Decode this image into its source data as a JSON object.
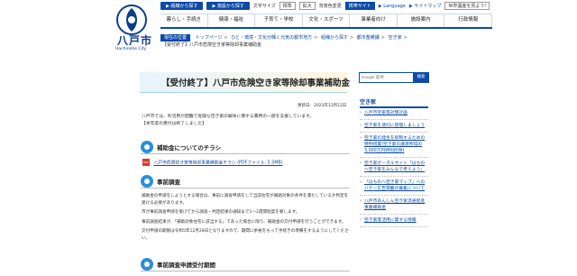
{
  "logo": {
    "city": "八戸市",
    "en": "Hachinohe City"
  },
  "topbar": {
    "btn1": "▶ 組織から探す",
    "btn2": "▶ 施設から探す",
    "size_label": "文字サイズ",
    "size_std": "標準",
    "size_big": "拡大",
    "color_label": "背景色変更",
    "mobile": "携帯サイト",
    "lang": "▶ Language",
    "sitemap": "▶ サイトマップ",
    "world": "世界遺産を見よう!"
  },
  "nav": [
    "暮らし・手続き",
    "健康・福祉",
    "子育て・学校",
    "文化・スポーツ",
    "事業者向け",
    "施設案内",
    "行政情報"
  ],
  "breadcrumb": {
    "here": "現在の位置",
    "items": [
      "トップページ",
      "ひと・環境・文化が輝く元気の都市地方",
      "組織から探す",
      "都市整備課",
      "空き家"
    ],
    "current": "【受付終了】八戸市危険空き家等除却事業補助金"
  },
  "page": {
    "title": "【受付終了】八戸市危険空き家等除却事業補助金",
    "updated": "更新日：2023年12月12日",
    "intro_1": "八戸市では、利活用が困難で危険な空き家の解体に要する費用の一部を支援しています。",
    "intro_2": "【本年度の受付は終了しました】"
  },
  "sections": {
    "leaflet_title": "補助金についてのチラシ",
    "pdf_icon": "PDF",
    "pdf_link": "八戸市危険空き家等除却事業補助金チラシ (PDFファイル: 5.5MB)",
    "prelim_title": "事前調査",
    "prelim_p1": "補助金の申請をしようとする場合は、事前に調査申請をして当該住宅が補助対象の条件を満たしているか判定を受ける必要があります。",
    "prelim_p2": "市が事前調査申請を受けてから調査・判定結果の通知まで1～2週間程度を要します。",
    "prelim_p3": "事前調査結果が、「補助対象住宅に該当する」であった場合に限り、補助金の交付申請を行うことができます。",
    "prelim_p4": "交付申請の期限は令和5年12月28日となりますので、期間に余裕をもって手続きの準備をするようにしてください。",
    "period_title": "事前調査申請受付期間"
  },
  "search": {
    "placeholder": "Google 提供",
    "button": "検索"
  },
  "side": {
    "title": "空き家",
    "items": [
      "八戸市空家等対策計画",
      "空き家を適切に管理しましょう",
      "空き家の発生を抑制するための特例措置(空き家の譲渡所得の3,000万円特別控除)",
      "空き家ポータルサイト「はちのへ空き家をみんなで考えよう」",
      "「はちのへ空き家マップ」へのバナー広告掲載の募集について",
      "八戸市あんしん空き家流通促進事業補助金",
      "空き家等活用に関する情報"
    ]
  }
}
